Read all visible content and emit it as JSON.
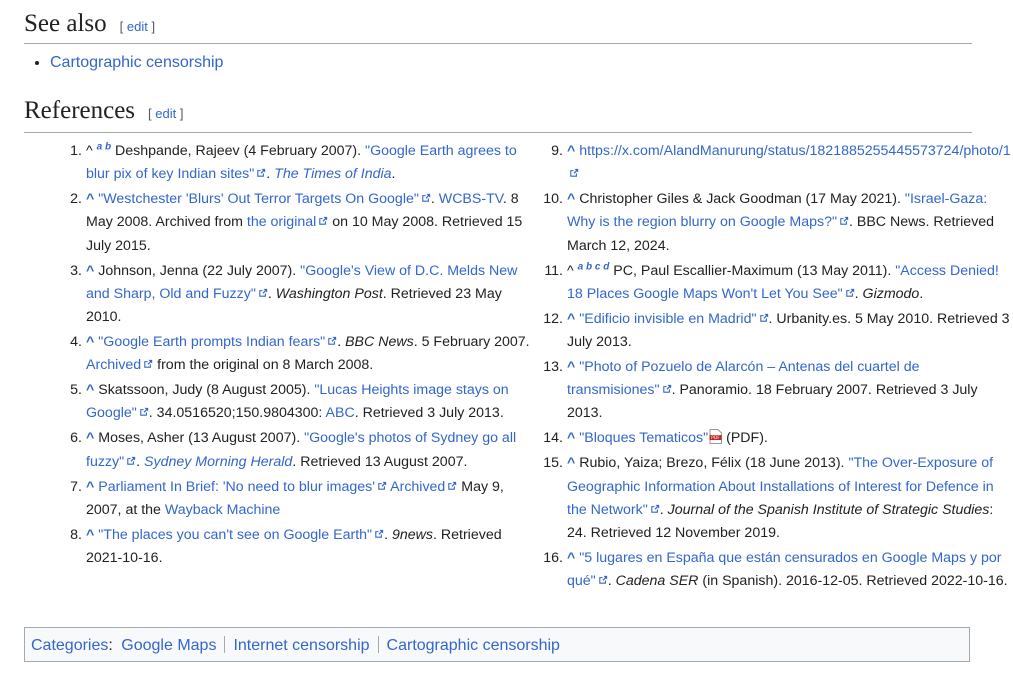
{
  "see_also": {
    "heading": "See also",
    "edit": "edit",
    "items": [
      "Cartographic censorship"
    ]
  },
  "references": {
    "heading": "References",
    "edit": "edit",
    "items": [
      {
        "n": "1.",
        "caret": "^",
        "sup": "a b",
        "a": "Deshpande, Rajeev (4 February 2007). ",
        "link": "\"Google Earth agrees to blur pix of key Indian sites\"",
        "b": ". ",
        "work": "The Times of India",
        "c": "."
      },
      {
        "n": "2.",
        "caret": "^",
        "link": "\"Westchester 'Blurs' Out Terror Targets On Google\"",
        "b": ". ",
        "link2": "WCBS-TV",
        "c": ". 8 May 2008. Archived from ",
        "link3": "the original",
        "d": " on 10 May 2008. Retrieved 15 July 2015."
      },
      {
        "n": "3.",
        "caret": "^",
        "a": "Johnson, Jenna (22 July 2007). ",
        "link": "\"Google's View of D.C. Melds New and Sharp, Old and Fuzzy\"",
        "b": ". ",
        "work": "Washington Post",
        "c": ". Retrieved 23 May 2010."
      },
      {
        "n": "4.",
        "caret": "^",
        "link": "\"Google Earth prompts Indian fears\"",
        "b": ". ",
        "work": "BBC News",
        "c": ". 5 February 2007. ",
        "link2": "Archived",
        "d": " from the original on 8 March 2008."
      },
      {
        "n": "5.",
        "caret": "^",
        "a": "Skatssoon, Judy (8 August 2005). ",
        "link": "\"Lucas Heights image stays on Google\"",
        "b": ". 34.0516520;150.9804300: ",
        "link2": "ABC",
        "c": ". Retrieved 3 July 2013."
      },
      {
        "n": "6.",
        "caret": "^",
        "a": "Moses, Asher (13 August 2007). ",
        "link": "\"Google's photos of Sydney go all fuzzy\"",
        "b": ". ",
        "work": "Sydney Morning Herald",
        "c": ". Retrieved 13 August 2007."
      },
      {
        "n": "7.",
        "caret": "^",
        "link": "Parliament In Brief: 'No need to blur images'",
        "link2": "Archived",
        "b": " May 9, 2007, at the ",
        "link3": "Wayback Machine"
      },
      {
        "n": "8.",
        "caret": "^",
        "link": "\"The places you can't see on Google Earth\"",
        "b": ". ",
        "work": "9news",
        "c": ". Retrieved 2021-10-16."
      },
      {
        "n": "9.",
        "caret": "^",
        "link": "https://x.com/AlandManurung/status/1821885255445573724/photo/1"
      },
      {
        "n": "10.",
        "caret": "^",
        "a": "Christopher Giles & Jack Goodman (17 May 2021). ",
        "link": "\"Israel-Gaza: Why is the region blurry on Google Maps?\"",
        "b": ". BBC News. Retrieved March 12, 2024."
      },
      {
        "n": "11.",
        "caret": "^",
        "sup": "a b c d",
        "a": "PC, Paul Escallier-Maximum (13 May 2011). ",
        "link": "\"Access Denied! 18 Places Google Maps Won't Let You See\"",
        "b": ". ",
        "work": "Gizmodo",
        "c": "."
      },
      {
        "n": "12.",
        "caret": "^",
        "link": "\"Edificio invisible en Madrid\"",
        "b": ". Urbanity.es. 5 May 2010. Retrieved 3 July 2013."
      },
      {
        "n": "13.",
        "caret": "^",
        "link": "\"Photo of Pozuelo de Alarcón – Antenas del cuartel de transmisiones\"",
        "b": ". Panoramio. 18 February 2007. Retrieved 3 July 2013."
      },
      {
        "n": "14.",
        "caret": "^",
        "link": "\"Bloques Tematicos\"",
        "b": " (PDF)."
      },
      {
        "n": "15.",
        "caret": "^",
        "a": "Rubio, Yaiza; Brezo, Félix (18 June 2013). ",
        "link": "\"The Over-Exposure of Geographic Information About Installations of Interest for Defence in the Network\"",
        "b": ". ",
        "work": "Journal of the Spanish Institute of Strategic Studies",
        "c": ": 24. Retrieved 12 November 2019."
      },
      {
        "n": "16.",
        "caret": "^",
        "link": "\"5 lugares en España que están censurados en Google Maps y por qué\"",
        "b": ". ",
        "work": "Cadena SER",
        "c": " (in Spanish). 2016-12-05. Retrieved 2022-10-16."
      }
    ]
  },
  "categories": {
    "label": "Categories",
    "colon": ":",
    "items": [
      "Google Maps",
      "Internet censorship",
      "Cartographic censorship"
    ]
  },
  "colors": {
    "link": "#3366cc",
    "visited": "#6b4ba1",
    "text": "#202122",
    "border": "#a2a9b1"
  }
}
